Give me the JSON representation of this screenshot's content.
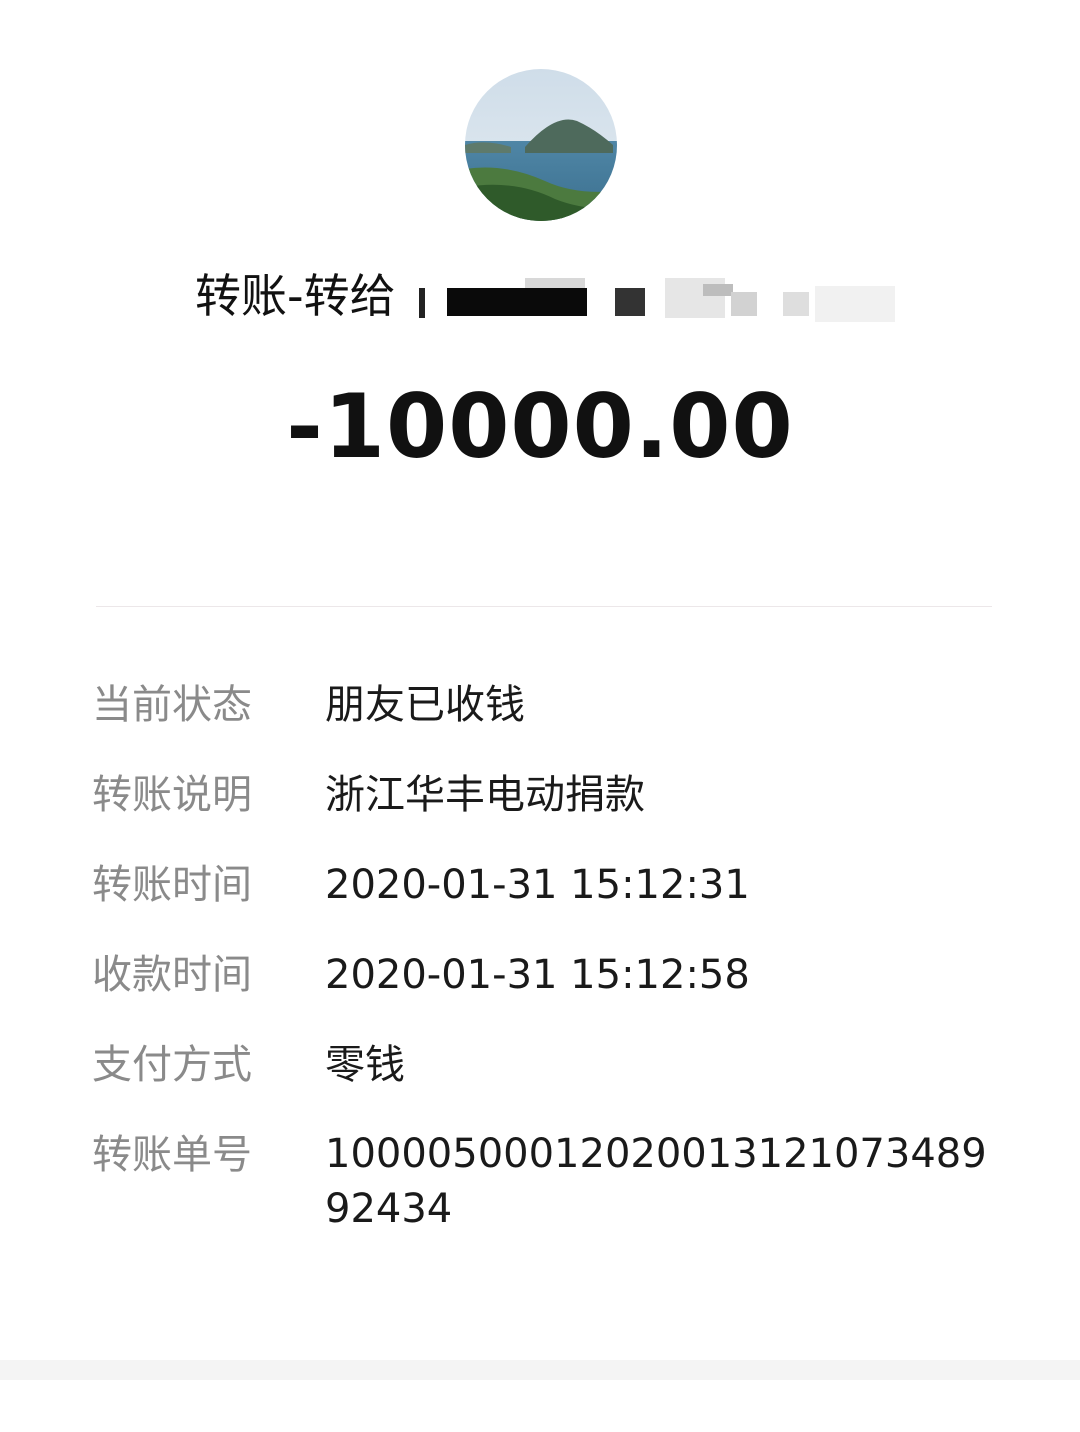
{
  "header": {
    "title_prefix": "转账-转给",
    "recipient_redacted": true
  },
  "transfer": {
    "amount": "-10000.00"
  },
  "details": [
    {
      "label": "当前状态",
      "value": "朋友已收钱"
    },
    {
      "label": "转账说明",
      "value": "浙江华丰电动捐款"
    },
    {
      "label": "转账时间",
      "value": "2020-01-31 15:12:31"
    },
    {
      "label": "收款时间",
      "value": "2020-01-31 15:12:58"
    },
    {
      "label": "支付方式",
      "value": "零钱"
    },
    {
      "label": "转账单号",
      "value": "1000050001202001312107348992434"
    }
  ],
  "colors": {
    "label": "#8a8a8a",
    "value": "#1a1a1a",
    "amount": "#111111",
    "divider": "#ece7e9"
  }
}
